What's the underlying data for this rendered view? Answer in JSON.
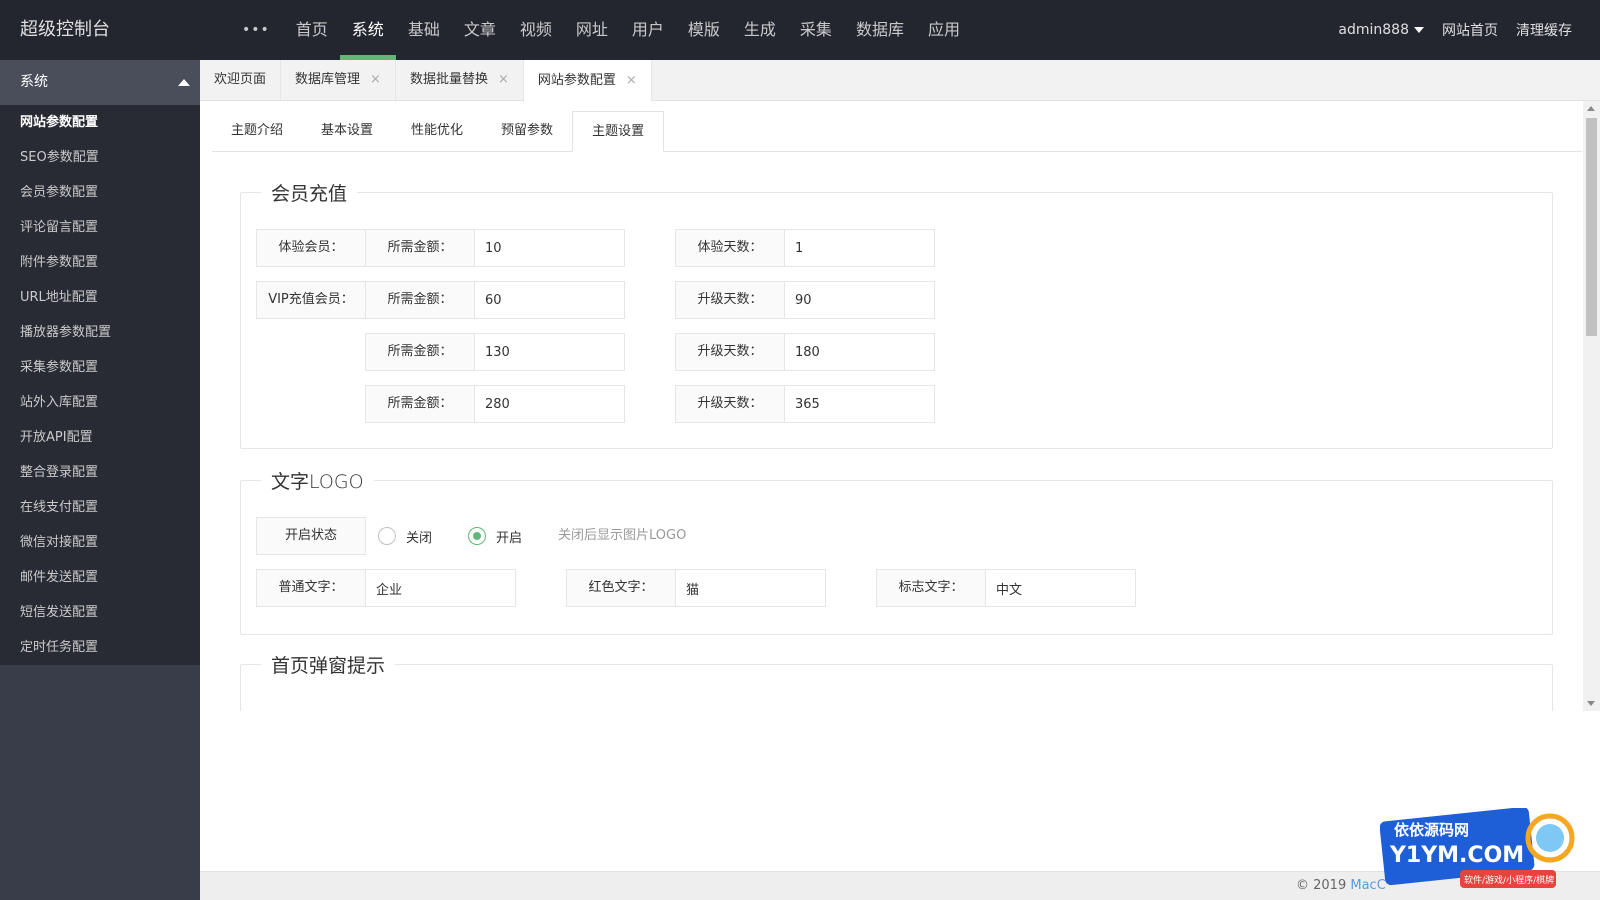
{
  "app": {
    "title": "超级控制台"
  },
  "topnav": {
    "more": "•••",
    "items": [
      "首页",
      "系统",
      "基础",
      "文章",
      "视频",
      "网址",
      "用户",
      "模版",
      "生成",
      "采集",
      "数据库",
      "应用"
    ],
    "active_index": 1
  },
  "topright": {
    "user": "admin888",
    "site_home": "网站首页",
    "clear_cache": "清理缓存"
  },
  "sidebar": {
    "section": "系统",
    "items": [
      "网站参数配置",
      "SEO参数配置",
      "会员参数配置",
      "评论留言配置",
      "附件参数配置",
      "URL地址配置",
      "播放器参数配置",
      "采集参数配置",
      "站外入库配置",
      "开放API配置",
      "整合登录配置",
      "在线支付配置",
      "微信对接配置",
      "邮件发送配置",
      "短信发送配置",
      "定时任务配置"
    ],
    "active_index": 0
  },
  "tabs": {
    "items": [
      "欢迎页面",
      "数据库管理",
      "数据批量替换",
      "网站参数配置"
    ],
    "close_glyph": "×",
    "active_index": 3
  },
  "subtabs": {
    "items": [
      "主题介绍",
      "基本设置",
      "性能优化",
      "预留参数",
      "主题设置"
    ],
    "active_index": 4
  },
  "member": {
    "legend": "会员充值",
    "trial_label": "体验会员：",
    "vip_label": "VIP充值会员：",
    "amount_label": "所需金额：",
    "trial_days_label": "体验天数：",
    "upgrade_days_label": "升级天数：",
    "trial_amount": "10",
    "trial_days": "1",
    "vip_rows": [
      {
        "amount": "60",
        "days": "90"
      },
      {
        "amount": "130",
        "days": "180"
      },
      {
        "amount": "280",
        "days": "365"
      }
    ]
  },
  "textlogo": {
    "legend": "文字LOGO",
    "status_label": "开启状态",
    "off_label": "关闭",
    "on_label": "开启",
    "selected": "on",
    "hint": "关闭后显示图片LOGO",
    "normal_label": "普通文字：",
    "normal_value": "企业",
    "red_label": "红色文字：",
    "red_value": "猫",
    "mark_label": "标志文字：",
    "mark_value": "中文"
  },
  "popup": {
    "legend": "首页弹窗提示"
  },
  "footer": {
    "copyright": "© 2019 ",
    "brand": "MacC"
  },
  "watermark": {
    "line1": "依依源码网",
    "line2": "Y1YM.COM",
    "line3": "软件/游戏/小程序/棋牌"
  },
  "colors": {
    "header_bg": "#23262e",
    "sidebar_bg": "#393d49",
    "accent": "#5fb878"
  }
}
